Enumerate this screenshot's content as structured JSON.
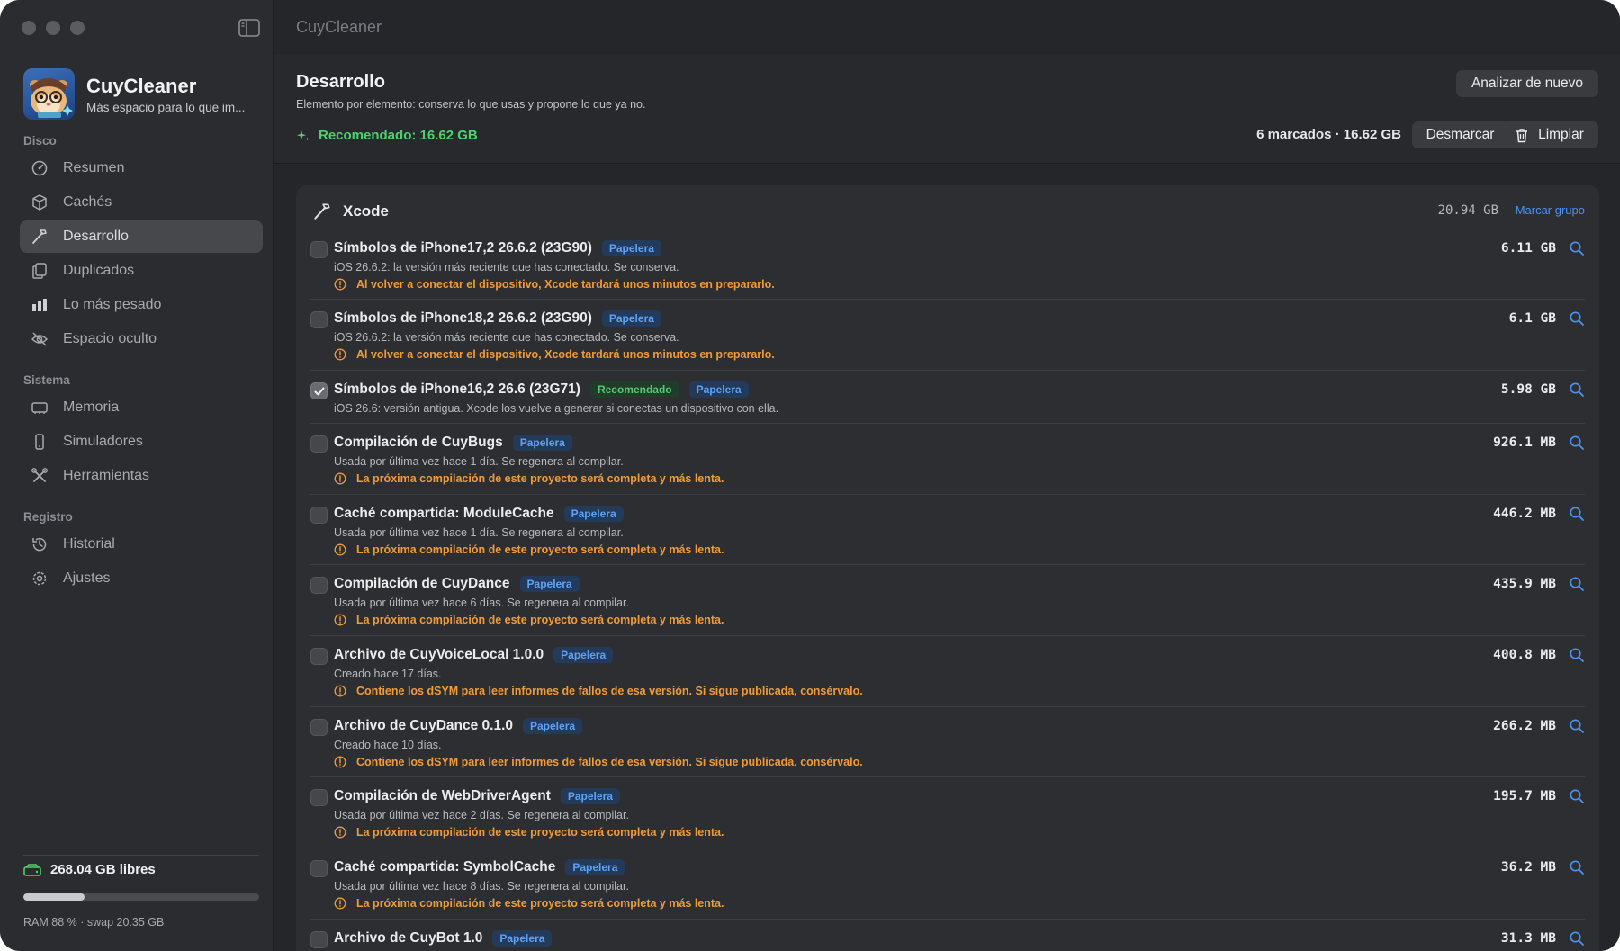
{
  "window": {
    "title": "CuyCleaner"
  },
  "brand": {
    "name": "CuyCleaner",
    "tagline": "Más espacio para lo que im..."
  },
  "sidebar": {
    "sections": [
      {
        "label": "Disco"
      },
      {
        "label": "Sistema"
      },
      {
        "label": "Registro"
      }
    ],
    "items": [
      {
        "label": "Resumen",
        "icon": "gauge-icon"
      },
      {
        "label": "Cachés",
        "icon": "box-icon"
      },
      {
        "label": "Desarrollo",
        "icon": "hammer-icon",
        "active": true
      },
      {
        "label": "Duplicados",
        "icon": "duplicate-icon"
      },
      {
        "label": "Lo más pesado",
        "icon": "bar-chart-icon"
      },
      {
        "label": "Espacio oculto",
        "icon": "eye-slash-icon"
      },
      {
        "label": "Memoria",
        "icon": "memory-icon"
      },
      {
        "label": "Simuladores",
        "icon": "phone-icon"
      },
      {
        "label": "Herramientas",
        "icon": "tools-icon"
      },
      {
        "label": "Historial",
        "icon": "history-icon"
      },
      {
        "label": "Ajustes",
        "icon": "gear-icon"
      }
    ],
    "disk": {
      "free_label": "268.04 GB libres",
      "used_fraction": 0.26,
      "ram_label": "RAM 88 % · swap 20.35 GB"
    }
  },
  "header": {
    "title": "Desarrollo",
    "subtitle": "Elemento por elemento: conserva lo que usas y propone lo que ya no.",
    "recommended": "Recomendado: 16.62 GB",
    "rescan_label": "Analizar de nuevo",
    "marked_summary": "6 marcados · 16.62 GB",
    "unmark_label": "Desmarcar",
    "clean_label": "Limpiar"
  },
  "group": {
    "name": "Xcode",
    "size": "20.94 GB",
    "mark_label": "Marcar grupo",
    "badge_trash": "Papelera",
    "badge_recommended": "Recomendado",
    "items": [
      {
        "title": "Símbolos de iPhone17,2 26.6.2 (23G90)",
        "desc": "iOS 26.6.2: la versión más reciente que has conectado. Se conserva.",
        "warn": "Al volver a conectar el dispositivo, Xcode tardará unos minutos en prepararlo.",
        "size": "6.11 GB",
        "checked": false,
        "recommended": false
      },
      {
        "title": "Símbolos de iPhone18,2 26.6.2 (23G90)",
        "desc": "iOS 26.6.2: la versión más reciente que has conectado. Se conserva.",
        "warn": "Al volver a conectar el dispositivo, Xcode tardará unos minutos en prepararlo.",
        "size": "6.1 GB",
        "checked": false,
        "recommended": false
      },
      {
        "title": "Símbolos de iPhone16,2 26.6 (23G71)",
        "desc": "iOS 26.6: versión antigua. Xcode los vuelve a generar si conectas un dispositivo con ella.",
        "warn": "",
        "size": "5.98 GB",
        "checked": true,
        "recommended": true
      },
      {
        "title": "Compilación de CuyBugs",
        "desc": "Usada por última vez hace 1 día. Se regenera al compilar.",
        "warn": "La próxima compilación de este proyecto será completa y más lenta.",
        "size": "926.1 MB",
        "checked": false,
        "recommended": false
      },
      {
        "title": "Caché compartida: ModuleCache",
        "desc": "Usada por última vez hace 1 día. Se regenera al compilar.",
        "warn": "La próxima compilación de este proyecto será completa y más lenta.",
        "size": "446.2 MB",
        "checked": false,
        "recommended": false
      },
      {
        "title": "Compilación de CuyDance",
        "desc": "Usada por última vez hace 6 días. Se regenera al compilar.",
        "warn": "La próxima compilación de este proyecto será completa y más lenta.",
        "size": "435.9 MB",
        "checked": false,
        "recommended": false
      },
      {
        "title": "Archivo de CuyVoiceLocal 1.0.0",
        "desc": "Creado hace 17 días.",
        "warn": "Contiene los dSYM para leer informes de fallos de esa versión. Si sigue publicada, consérvalo.",
        "size": "400.8 MB",
        "checked": false,
        "recommended": false
      },
      {
        "title": "Archivo de CuyDance 0.1.0",
        "desc": "Creado hace 10 días.",
        "warn": "Contiene los dSYM para leer informes de fallos de esa versión. Si sigue publicada, consérvalo.",
        "size": "266.2 MB",
        "checked": false,
        "recommended": false
      },
      {
        "title": "Compilación de WebDriverAgent",
        "desc": "Usada por última vez hace 2 días. Se regenera al compilar.",
        "warn": "La próxima compilación de este proyecto será completa y más lenta.",
        "size": "195.7 MB",
        "checked": false,
        "recommended": false
      },
      {
        "title": "Caché compartida: SymbolCache",
        "desc": "Usada por última vez hace 8 días. Se regenera al compilar.",
        "warn": "La próxima compilación de este proyecto será completa y más lenta.",
        "size": "36.2 MB",
        "checked": false,
        "recommended": false
      },
      {
        "title": "Archivo de CuyBot 1.0",
        "desc": "",
        "warn": "",
        "size": "31.3 MB",
        "checked": false,
        "recommended": false
      }
    ]
  }
}
